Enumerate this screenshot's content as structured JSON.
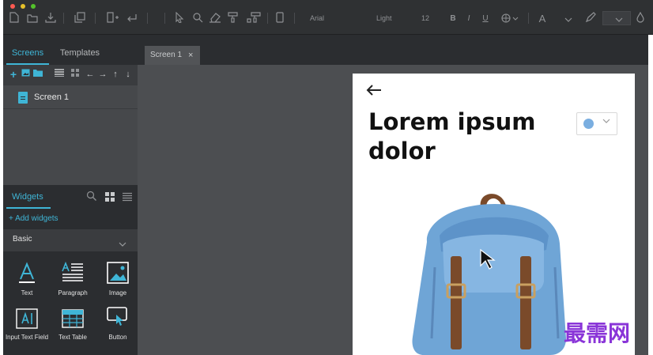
{
  "toolbar": {
    "font_name": "Arial",
    "font_weight": "Light",
    "font_size": "12",
    "bold": "B",
    "italic": "I",
    "underline": "U",
    "text_color": "A"
  },
  "left_panel": {
    "tabs": [
      "Screens",
      "Templates"
    ],
    "screens": [
      {
        "label": "Screen 1"
      }
    ],
    "widgets_title": "Widgets",
    "add_widgets": "+ Add widgets",
    "category": "Basic",
    "widgets": [
      {
        "label": "Text",
        "icon": "text-icon"
      },
      {
        "label": "Paragraph",
        "icon": "paragraph-icon"
      },
      {
        "label": "Image",
        "icon": "image-icon"
      },
      {
        "label": "Input Text Field",
        "icon": "input-text-icon"
      },
      {
        "label": "Text Table",
        "icon": "table-icon"
      },
      {
        "label": "Button",
        "icon": "button-icon"
      }
    ]
  },
  "document_tab": {
    "label": "Screen 1",
    "close": "×"
  },
  "canvas": {
    "heading": "Lorem ipsum dolor",
    "dropdown_color": "#7aaee0"
  },
  "watermark": "最需网",
  "colors": {
    "accent": "#3fb5d6",
    "panel": "#2b2d30",
    "canvas": "#4c4e51"
  }
}
